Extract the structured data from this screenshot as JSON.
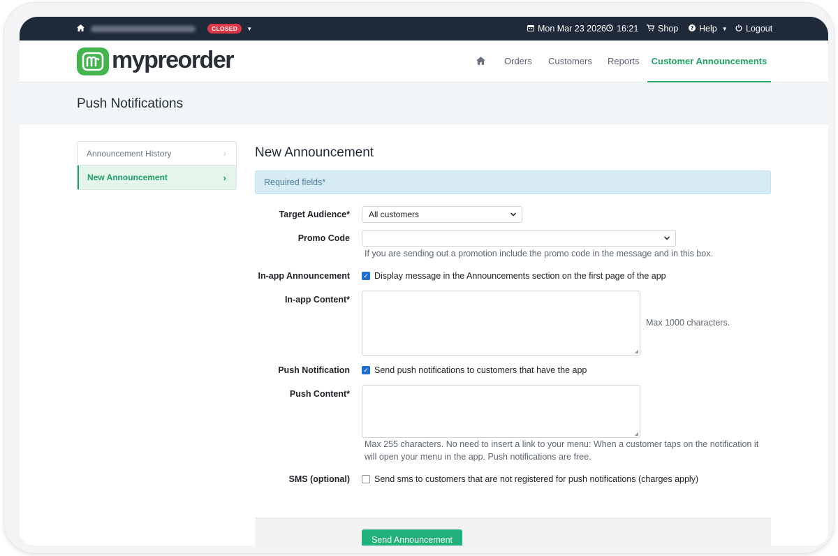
{
  "topbar": {
    "status_badge": "CLOSED",
    "date": "Mon Mar 23 2026",
    "time": "16:21",
    "shop": "Shop",
    "help": "Help",
    "logout": "Logout"
  },
  "nav": {
    "logo_text": "mypreorder",
    "items": [
      "Orders",
      "Customers",
      "Reports",
      "Customer Announcements"
    ],
    "active": "Customer Announcements"
  },
  "page": {
    "title": "Push Notifications"
  },
  "sidebar": {
    "items": [
      {
        "label": "Announcement History",
        "active": false
      },
      {
        "label": "New Announcement",
        "active": true
      }
    ]
  },
  "form": {
    "title": "New Announcement",
    "required_note": "Required fields*",
    "target_audience": {
      "label": "Target Audience*",
      "value": "All customers"
    },
    "promo_code": {
      "label": "Promo Code",
      "value": "",
      "help": "If you are sending out a promotion include the promo code in the message and in this box."
    },
    "in_app": {
      "label": "In-app Announcement",
      "checked": true,
      "text": "Display message in the Announcements section on the first page of the app"
    },
    "in_app_content": {
      "label": "In-app Content*",
      "value": "",
      "help": "Max 1000 characters."
    },
    "push": {
      "label": "Push Notification",
      "checked": true,
      "text": "Send push notifications to customers that have the app"
    },
    "push_content": {
      "label": "Push Content*",
      "value": "",
      "help_line1": "Max 255 characters. No need to insert a link to your menu: When a customer taps on the notification it",
      "help_line2": "will open your menu in the app. Push notifications are free."
    },
    "sms": {
      "label": "SMS (optional)",
      "checked": false,
      "text": "Send sms to customers that are not registered for push notifications (charges apply)"
    },
    "submit_label": "Send Announcement"
  },
  "colors": {
    "brand_green": "#20b07a",
    "topbar": "#1e2a3a",
    "danger": "#dc3545"
  },
  "icons": [
    "home-icon",
    "calendar-icon",
    "clock-icon",
    "cart-icon",
    "question-icon",
    "power-icon",
    "chevron-right-icon",
    "caret-down-icon"
  ]
}
